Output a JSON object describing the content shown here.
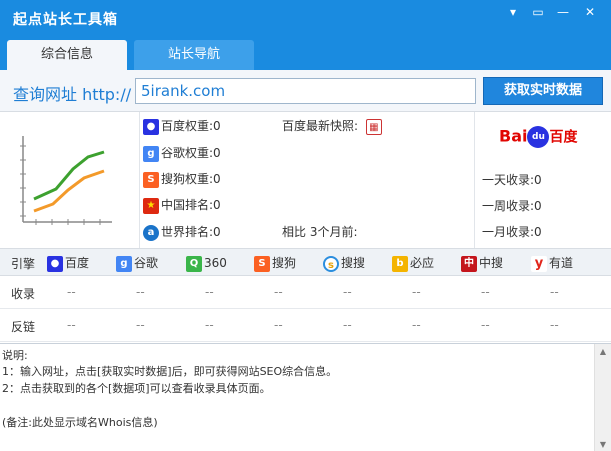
{
  "window": {
    "title": "起点站长工具箱",
    "controls": [
      "▾",
      "▭",
      "—",
      "✕"
    ],
    "accent": "#1a8be0"
  },
  "tabs": [
    {
      "label": "综合信息",
      "active": true
    },
    {
      "label": "站长导航",
      "active": false
    }
  ],
  "url_row": {
    "label": "查询网址 http://",
    "value": "5irank.com",
    "button_label": "获取实时数据"
  },
  "metrics": {
    "baidu_weight": "百度权重:0",
    "google_weight": "谷歌权重:0",
    "sogou_weight": "搜狗权重:0",
    "china_rank": "中国排名:0",
    "world_rank": "世界排名:0",
    "baidu_snapshot": "百度最新快照:",
    "compare": "相比  3个月前:"
  },
  "right_panel": {
    "logo_bai": "Bai",
    "logo_du": "du",
    "logo_cn": "百度",
    "day": "一天收录:0",
    "week": "一周收录:0",
    "month": "一月收录:0"
  },
  "engines": {
    "row_label": "引擎",
    "items": [
      {
        "name": "百度",
        "icon": "paw-icon",
        "color": "#2932e1"
      },
      {
        "name": "谷歌",
        "icon": "google-icon",
        "color": "#4285f4"
      },
      {
        "name": "360",
        "icon": "search-360-icon",
        "color": "#3ab54a"
      },
      {
        "name": "搜狗",
        "icon": "sogou-icon",
        "color": "#fb6022"
      },
      {
        "name": "搜搜",
        "icon": "soso-icon",
        "color": "#2b8ede"
      },
      {
        "name": "必应",
        "icon": "bing-icon",
        "color": "#f4b400"
      },
      {
        "name": "中搜",
        "icon": "zhongsou-icon",
        "color": "#c4151c"
      },
      {
        "name": "有道",
        "icon": "youdao-icon",
        "color": "#e1251b"
      }
    ]
  },
  "indexed_row": {
    "label": "收录",
    "values": [
      "--",
      "--",
      "--",
      "--",
      "--",
      "--",
      "--",
      "--"
    ]
  },
  "backlink_row": {
    "label": "反链",
    "values": [
      "--",
      "--",
      "--",
      "--",
      "--",
      "--",
      "--",
      "--"
    ]
  },
  "description": {
    "heading": "说明:",
    "line1": "1：输入网址，点击[获取实时数据]后，即可获得网站SEO综合信息。",
    "line2": "2：点击获取到的各个[数据项]可以查看收录具体页面。",
    "note": "(备注:此处显示域名Whois信息)"
  }
}
